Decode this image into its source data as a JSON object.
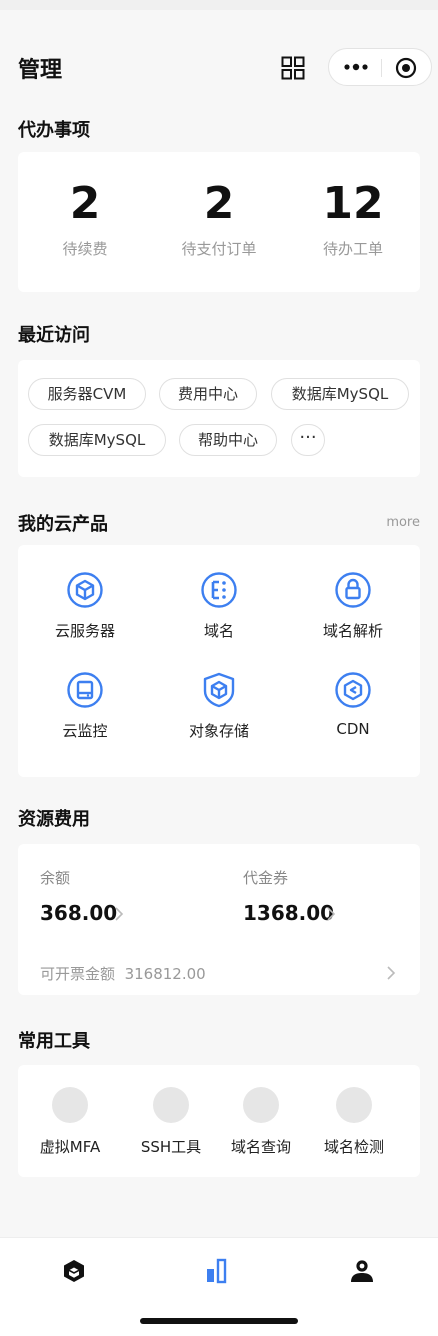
{
  "header": {
    "title": "管理",
    "icons": [
      "grid-icon",
      "more-dots-icon",
      "target-icon"
    ]
  },
  "todos": {
    "section_title": "代办事项",
    "items": [
      {
        "count": "2",
        "label": "待续费"
      },
      {
        "count": "2",
        "label": "待支付订单"
      },
      {
        "count": "12",
        "label": "待办工单"
      }
    ]
  },
  "recent": {
    "section_title": "最近访问",
    "chips": [
      "服务器CVM",
      "费用中心",
      "数据库MySQL",
      "数据库MySQL",
      "帮助中心"
    ],
    "more_label": "···"
  },
  "products": {
    "section_title": "我的云产品",
    "more_label": "more",
    "accent": "#3d7ff0",
    "items": [
      {
        "label": "云服务器",
        "icon": "cloud-server-icon"
      },
      {
        "label": "域名",
        "icon": "domain-icon"
      },
      {
        "label": "域名解析",
        "icon": "dns-lock-icon"
      },
      {
        "label": "云监控",
        "icon": "monitor-icon"
      },
      {
        "label": "对象存储",
        "icon": "storage-shield-icon"
      },
      {
        "label": "CDN",
        "icon": "cdn-icon"
      }
    ]
  },
  "fees": {
    "section_title": "资源费用",
    "balance_label": "余额",
    "balance_value": "368.00",
    "voucher_label": "代金券",
    "voucher_value": "1368.00",
    "invoice_label": "可开票金额",
    "invoice_value": "316812.00"
  },
  "tools": {
    "section_title": "常用工具",
    "items": [
      "虚拟MFA",
      "SSH工具",
      "域名查询",
      "域名检测"
    ]
  },
  "tabbar": {
    "active_color": "#3d7ff0",
    "tabs": [
      "cube-icon",
      "chart-bars-icon",
      "user-icon"
    ]
  }
}
